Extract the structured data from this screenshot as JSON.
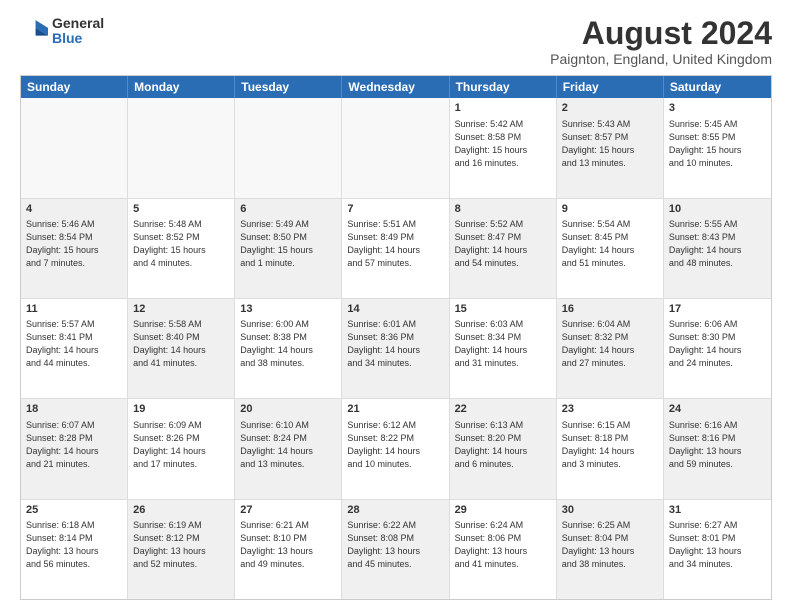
{
  "logo": {
    "general": "General",
    "blue": "Blue"
  },
  "title": "August 2024",
  "subtitle": "Paignton, England, United Kingdom",
  "headers": [
    "Sunday",
    "Monday",
    "Tuesday",
    "Wednesday",
    "Thursday",
    "Friday",
    "Saturday"
  ],
  "weeks": [
    [
      {
        "day": "",
        "lines": [],
        "empty": true
      },
      {
        "day": "",
        "lines": [],
        "empty": true
      },
      {
        "day": "",
        "lines": [],
        "empty": true
      },
      {
        "day": "",
        "lines": [],
        "empty": true
      },
      {
        "day": "1",
        "lines": [
          "Sunrise: 5:42 AM",
          "Sunset: 8:58 PM",
          "Daylight: 15 hours",
          "and 16 minutes."
        ],
        "shaded": false
      },
      {
        "day": "2",
        "lines": [
          "Sunrise: 5:43 AM",
          "Sunset: 8:57 PM",
          "Daylight: 15 hours",
          "and 13 minutes."
        ],
        "shaded": true
      },
      {
        "day": "3",
        "lines": [
          "Sunrise: 5:45 AM",
          "Sunset: 8:55 PM",
          "Daylight: 15 hours",
          "and 10 minutes."
        ],
        "shaded": false
      }
    ],
    [
      {
        "day": "4",
        "lines": [
          "Sunrise: 5:46 AM",
          "Sunset: 8:54 PM",
          "Daylight: 15 hours",
          "and 7 minutes."
        ],
        "shaded": true
      },
      {
        "day": "5",
        "lines": [
          "Sunrise: 5:48 AM",
          "Sunset: 8:52 PM",
          "Daylight: 15 hours",
          "and 4 minutes."
        ],
        "shaded": false
      },
      {
        "day": "6",
        "lines": [
          "Sunrise: 5:49 AM",
          "Sunset: 8:50 PM",
          "Daylight: 15 hours",
          "and 1 minute."
        ],
        "shaded": true
      },
      {
        "day": "7",
        "lines": [
          "Sunrise: 5:51 AM",
          "Sunset: 8:49 PM",
          "Daylight: 14 hours",
          "and 57 minutes."
        ],
        "shaded": false
      },
      {
        "day": "8",
        "lines": [
          "Sunrise: 5:52 AM",
          "Sunset: 8:47 PM",
          "Daylight: 14 hours",
          "and 54 minutes."
        ],
        "shaded": true
      },
      {
        "day": "9",
        "lines": [
          "Sunrise: 5:54 AM",
          "Sunset: 8:45 PM",
          "Daylight: 14 hours",
          "and 51 minutes."
        ],
        "shaded": false
      },
      {
        "day": "10",
        "lines": [
          "Sunrise: 5:55 AM",
          "Sunset: 8:43 PM",
          "Daylight: 14 hours",
          "and 48 minutes."
        ],
        "shaded": true
      }
    ],
    [
      {
        "day": "11",
        "lines": [
          "Sunrise: 5:57 AM",
          "Sunset: 8:41 PM",
          "Daylight: 14 hours",
          "and 44 minutes."
        ],
        "shaded": false
      },
      {
        "day": "12",
        "lines": [
          "Sunrise: 5:58 AM",
          "Sunset: 8:40 PM",
          "Daylight: 14 hours",
          "and 41 minutes."
        ],
        "shaded": true
      },
      {
        "day": "13",
        "lines": [
          "Sunrise: 6:00 AM",
          "Sunset: 8:38 PM",
          "Daylight: 14 hours",
          "and 38 minutes."
        ],
        "shaded": false
      },
      {
        "day": "14",
        "lines": [
          "Sunrise: 6:01 AM",
          "Sunset: 8:36 PM",
          "Daylight: 14 hours",
          "and 34 minutes."
        ],
        "shaded": true
      },
      {
        "day": "15",
        "lines": [
          "Sunrise: 6:03 AM",
          "Sunset: 8:34 PM",
          "Daylight: 14 hours",
          "and 31 minutes."
        ],
        "shaded": false
      },
      {
        "day": "16",
        "lines": [
          "Sunrise: 6:04 AM",
          "Sunset: 8:32 PM",
          "Daylight: 14 hours",
          "and 27 minutes."
        ],
        "shaded": true
      },
      {
        "day": "17",
        "lines": [
          "Sunrise: 6:06 AM",
          "Sunset: 8:30 PM",
          "Daylight: 14 hours",
          "and 24 minutes."
        ],
        "shaded": false
      }
    ],
    [
      {
        "day": "18",
        "lines": [
          "Sunrise: 6:07 AM",
          "Sunset: 8:28 PM",
          "Daylight: 14 hours",
          "and 21 minutes."
        ],
        "shaded": true
      },
      {
        "day": "19",
        "lines": [
          "Sunrise: 6:09 AM",
          "Sunset: 8:26 PM",
          "Daylight: 14 hours",
          "and 17 minutes."
        ],
        "shaded": false
      },
      {
        "day": "20",
        "lines": [
          "Sunrise: 6:10 AM",
          "Sunset: 8:24 PM",
          "Daylight: 14 hours",
          "and 13 minutes."
        ],
        "shaded": true
      },
      {
        "day": "21",
        "lines": [
          "Sunrise: 6:12 AM",
          "Sunset: 8:22 PM",
          "Daylight: 14 hours",
          "and 10 minutes."
        ],
        "shaded": false
      },
      {
        "day": "22",
        "lines": [
          "Sunrise: 6:13 AM",
          "Sunset: 8:20 PM",
          "Daylight: 14 hours",
          "and 6 minutes."
        ],
        "shaded": true
      },
      {
        "day": "23",
        "lines": [
          "Sunrise: 6:15 AM",
          "Sunset: 8:18 PM",
          "Daylight: 14 hours",
          "and 3 minutes."
        ],
        "shaded": false
      },
      {
        "day": "24",
        "lines": [
          "Sunrise: 6:16 AM",
          "Sunset: 8:16 PM",
          "Daylight: 13 hours",
          "and 59 minutes."
        ],
        "shaded": true
      }
    ],
    [
      {
        "day": "25",
        "lines": [
          "Sunrise: 6:18 AM",
          "Sunset: 8:14 PM",
          "Daylight: 13 hours",
          "and 56 minutes."
        ],
        "shaded": false
      },
      {
        "day": "26",
        "lines": [
          "Sunrise: 6:19 AM",
          "Sunset: 8:12 PM",
          "Daylight: 13 hours",
          "and 52 minutes."
        ],
        "shaded": true
      },
      {
        "day": "27",
        "lines": [
          "Sunrise: 6:21 AM",
          "Sunset: 8:10 PM",
          "Daylight: 13 hours",
          "and 49 minutes."
        ],
        "shaded": false
      },
      {
        "day": "28",
        "lines": [
          "Sunrise: 6:22 AM",
          "Sunset: 8:08 PM",
          "Daylight: 13 hours",
          "and 45 minutes."
        ],
        "shaded": true
      },
      {
        "day": "29",
        "lines": [
          "Sunrise: 6:24 AM",
          "Sunset: 8:06 PM",
          "Daylight: 13 hours",
          "and 41 minutes."
        ],
        "shaded": false
      },
      {
        "day": "30",
        "lines": [
          "Sunrise: 6:25 AM",
          "Sunset: 8:04 PM",
          "Daylight: 13 hours",
          "and 38 minutes."
        ],
        "shaded": true
      },
      {
        "day": "31",
        "lines": [
          "Sunrise: 6:27 AM",
          "Sunset: 8:01 PM",
          "Daylight: 13 hours",
          "and 34 minutes."
        ],
        "shaded": false
      }
    ]
  ]
}
